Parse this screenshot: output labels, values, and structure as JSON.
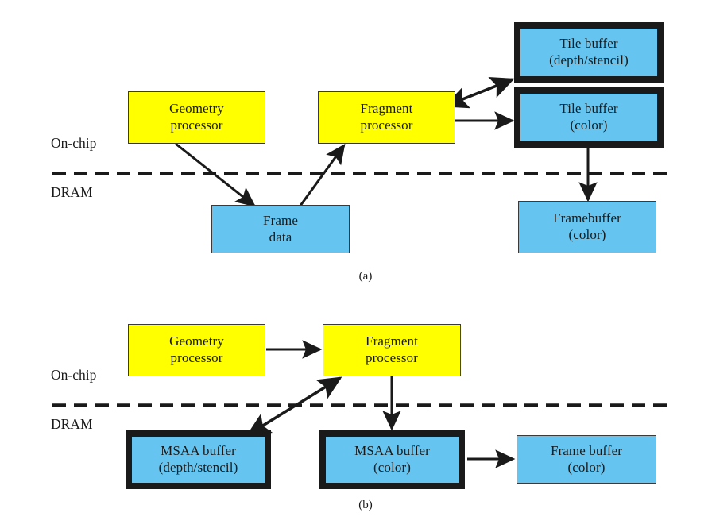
{
  "figure": {
    "panels": [
      {
        "id": "a",
        "caption": "(a)",
        "region_labels": {
          "top": "On-chip",
          "bottom": "DRAM"
        },
        "nodes": [
          {
            "id": "geometry-processor-a",
            "kind": "processor",
            "color": "#ffff00",
            "lines": [
              "Geometry",
              "processor"
            ]
          },
          {
            "id": "fragment-processor-a",
            "kind": "processor",
            "color": "#ffff00",
            "lines": [
              "Fragment",
              "processor"
            ]
          },
          {
            "id": "tile-buffer-depth-stencil",
            "kind": "on-chip-buffer",
            "color": "#66c5f0",
            "lines": [
              "Tile buffer",
              "(depth/stencil)"
            ]
          },
          {
            "id": "tile-buffer-color",
            "kind": "on-chip-buffer",
            "color": "#66c5f0",
            "lines": [
              "Tile buffer",
              "(color)"
            ]
          },
          {
            "id": "frame-data",
            "kind": "dram-buffer",
            "color": "#66c5f0",
            "lines": [
              "Frame",
              "data"
            ]
          },
          {
            "id": "framebuffer-color",
            "kind": "dram-buffer",
            "color": "#66c5f0",
            "lines": [
              "Framebuffer",
              "(color)"
            ]
          }
        ],
        "edges": [
          {
            "from": "geometry-processor-a",
            "to": "frame-data",
            "heads": "single"
          },
          {
            "from": "frame-data",
            "to": "fragment-processor-a",
            "heads": "single"
          },
          {
            "from": "fragment-processor-a",
            "to": "tile-buffer-depth-stencil",
            "heads": "double"
          },
          {
            "from": "fragment-processor-a",
            "to": "tile-buffer-color",
            "heads": "single"
          },
          {
            "from": "tile-buffer-color",
            "to": "framebuffer-color",
            "heads": "single"
          }
        ]
      },
      {
        "id": "b",
        "caption": "(b)",
        "region_labels": {
          "top": "On-chip",
          "bottom": "DRAM"
        },
        "nodes": [
          {
            "id": "geometry-processor-b",
            "kind": "processor",
            "color": "#ffff00",
            "lines": [
              "Geometry",
              "processor"
            ]
          },
          {
            "id": "fragment-processor-b",
            "kind": "processor",
            "color": "#ffff00",
            "lines": [
              "Fragment",
              "processor"
            ]
          },
          {
            "id": "msaa-buffer-depth-stencil",
            "kind": "dram-buffer-thick",
            "color": "#66c5f0",
            "lines": [
              "MSAA buffer",
              "(depth/stencil)"
            ]
          },
          {
            "id": "msaa-buffer-color",
            "kind": "dram-buffer-thick",
            "color": "#66c5f0",
            "lines": [
              "MSAA buffer",
              "(color)"
            ]
          },
          {
            "id": "frame-buffer-color",
            "kind": "dram-buffer",
            "color": "#66c5f0",
            "lines": [
              "Frame buffer",
              "(color)"
            ]
          }
        ],
        "edges": [
          {
            "from": "geometry-processor-b",
            "to": "fragment-processor-b",
            "heads": "single"
          },
          {
            "from": "fragment-processor-b",
            "to": "msaa-buffer-depth-stencil",
            "heads": "double"
          },
          {
            "from": "fragment-processor-b",
            "to": "msaa-buffer-color",
            "heads": "single"
          },
          {
            "from": "msaa-buffer-color",
            "to": "frame-buffer-color",
            "heads": "single"
          }
        ]
      }
    ],
    "colors": {
      "processor_fill": "#ffff00",
      "buffer_fill": "#66c5f0",
      "stroke": "#1a1a1a",
      "thin_border": "#3a3a3a",
      "background": "#ffffff"
    }
  },
  "panel_a": {
    "caption": "(a)",
    "label_onchip": "On-chip",
    "label_dram": "DRAM",
    "geometry_line1": "Geometry",
    "geometry_line2": "processor",
    "fragment_line1": "Fragment",
    "fragment_line2": "processor",
    "tile_depth_line1": "Tile buffer",
    "tile_depth_line2": "(depth/stencil)",
    "tile_color_line1": "Tile buffer",
    "tile_color_line2": "(color)",
    "frame_data_line1": "Frame",
    "frame_data_line2": "data",
    "framebuffer_line1": "Framebuffer",
    "framebuffer_line2": "(color)"
  },
  "panel_b": {
    "caption": "(b)",
    "label_onchip": "On-chip",
    "label_dram": "DRAM",
    "geometry_line1": "Geometry",
    "geometry_line2": "processor",
    "fragment_line1": "Fragment",
    "fragment_line2": "processor",
    "msaa_depth_line1": "MSAA buffer",
    "msaa_depth_line2": "(depth/stencil)",
    "msaa_color_line1": "MSAA buffer",
    "msaa_color_line2": "(color)",
    "frame_buffer_line1": "Frame buffer",
    "frame_buffer_line2": "(color)"
  }
}
